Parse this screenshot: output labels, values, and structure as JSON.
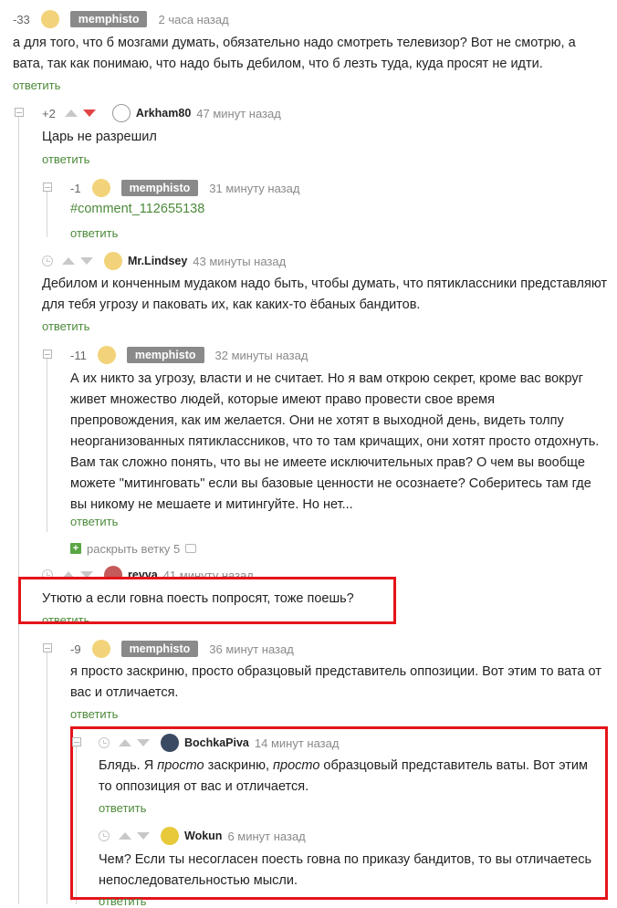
{
  "colors": {
    "reply": "#4c8a3a",
    "badge": "#8a8a8a",
    "highlight": "#e5131a",
    "downvote": "#e24545"
  },
  "comments": [
    {
      "rating": "-33",
      "author": "memphisto",
      "time": "2 часа назад",
      "text": "а для того, что б мозгами думать, обязательно надо смотреть телевизор? Вот не смотрю, а вата, так как понимаю, что надо быть дебилом, что б лезть туда, куда просят не идти.",
      "reply": "ответить",
      "avatar_icon": "robot-avatar-icon"
    },
    {
      "rating": "+2",
      "author": "Arkham80",
      "time": "47 минут назад",
      "text": "Царь не разрешил",
      "reply": "ответить",
      "avatar_icon": "sketch-avatar-icon"
    },
    {
      "rating": "-1",
      "author": "memphisto",
      "time": "31 минуту назад",
      "text": "#comment_112655138",
      "reply": "ответить",
      "avatar_icon": "robot-avatar-icon"
    },
    {
      "author": "Mr.Lindsey",
      "time": "43 минуты назад",
      "text": "Дебилом и конченным мудаком надо быть, чтобы думать, что пятиклассники представляют для тебя угрозу и паковать их, как каких-то ёбаных бандитов.",
      "reply": "ответить",
      "avatar_icon": "robot-avatar-icon"
    },
    {
      "rating": "-11",
      "author": "memphisto",
      "time": "32 минуты назад",
      "text": "А их никто за угрозу, власти и не считает. Но я вам открою секрет, кроме вас вокруг живет множество людей, которые имеют право провести свое время препровождения, как им желается. Они не хотят в выходной день, видеть толпу неорганизованных пятиклассников, что то там кричащих, они хотят просто отдохнуть. Вам так сложно понять, что вы не имеете исключительных прав? О чем вы вообще можете \"митинговать\" если вы базовые ценности не осознаете? Соберитесь там где вы никому не мешаете и митингуйте. Но нет...",
      "reply": "ответить",
      "expand": "раскрыть ветку 5",
      "avatar_icon": "robot-avatar-icon"
    },
    {
      "author": "revya",
      "time": "41 минуту назад",
      "text": "Утютю а если говна поесть попросят, тоже поешь?",
      "reply": "ответить",
      "avatar_icon": "photo-avatar-icon"
    },
    {
      "rating": "-9",
      "author": "memphisto",
      "time": "36 минут назад",
      "text": "я просто заскриню, просто образцовый представитель оппозиции. Вот этим то вата от вас и отличается.",
      "reply": "ответить",
      "avatar_icon": "robot-avatar-icon"
    },
    {
      "author": "BochkaPiva",
      "time": "14 минут назад",
      "text_parts": [
        "Блядь. Я ",
        "просто",
        " заскриню, ",
        "просто",
        " образцовый представитель ваты. Вот этим то оппозиция от вас и отличается."
      ],
      "reply": "ответить",
      "avatar_icon": "photo-avatar-icon"
    },
    {
      "author": "Wokun",
      "time": "6 минут назад",
      "text": "Чем? Если ты несогласен поесть говна по приказу бандитов, то вы отличаетесь непоследовательностью мысли.",
      "reply": "ответить",
      "avatar_icon": "banana-avatar-icon"
    }
  ]
}
